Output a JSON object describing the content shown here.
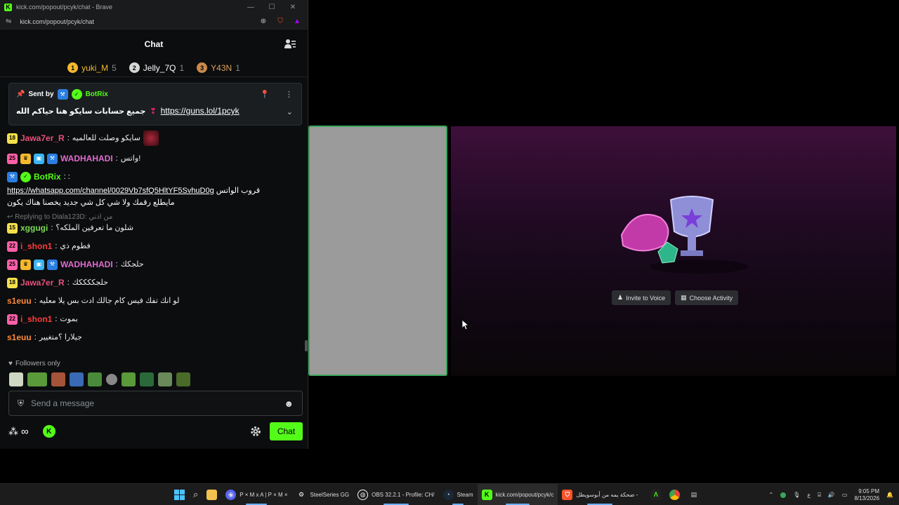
{
  "browser": {
    "window_title": "kick.com/popout/pcyk/chat - Brave",
    "url": "kick.com/popout/pcyk/chat"
  },
  "chat": {
    "header": "Chat",
    "leaderboard": [
      {
        "rank": "1",
        "name": "yuki_M",
        "count": "5",
        "color": "#f5b82e"
      },
      {
        "rank": "2",
        "name": "Jelly_7Q",
        "count": "1",
        "color": "#d8d8d8"
      },
      {
        "rank": "3",
        "name": "Y43N",
        "count": "1",
        "color": "#c98a4b"
      }
    ],
    "pinned": {
      "sent_by_label": "Sent by",
      "author": "BotRix",
      "text": "جميع حسابات سايكو هنا حياكم الله",
      "link": "https://guns.lol/1pcyk"
    },
    "messages": [
      {
        "badge": "18",
        "user": "Jawa7er_R",
        "text": "سايكو وصلت للعالميه"
      },
      {
        "badge": "25",
        "user": "WADHAHADI",
        "text": "واتس!"
      },
      {
        "user": "BotRix",
        "line1": "https://whatsapp.com/channel/0029Vb7sfQ5HltYF5SvhuD0g",
        "line1_suffix": "قروب الواتس",
        "line2": "مايطلع رقمك ولا شي كل شي جديد يخصنا هناك يكون"
      },
      {
        "reply": "Replying to Diala123D: من اذني",
        "badge": "15",
        "user": "xggugi",
        "text": "شلون ما تعرفين الملكه؟"
      },
      {
        "badge": "22",
        "user": "i_shon1",
        "text": "فطوم ذي"
      },
      {
        "badge": "25",
        "user": "WADHAHADI",
        "text": "حلجكك"
      },
      {
        "badge": "18",
        "user": "Jawa7er_R",
        "text": "حلجككككك"
      },
      {
        "user": "s1euu",
        "text": "لو انك تفك فيس كام جالك ادت بس يلا معليه"
      },
      {
        "badge": "22",
        "user": "i_shon1",
        "text": "بموت"
      },
      {
        "user": "s1euu",
        "text": "جيلارا ؟متغيير"
      }
    ],
    "followers_only": "Followers only",
    "composer_placeholder": "Send a message",
    "send_label": "Chat"
  },
  "activity": {
    "invite_label": "Invite to Voice",
    "choose_label": "Choose Activity"
  },
  "taskbar": {
    "items": [
      {
        "label": "P × M x A | P × M ×",
        "color": "#5865f2"
      },
      {
        "label": "SteelSeries GG",
        "color": "#ff6b00"
      },
      {
        "label": "OBS 32.2.1 - Profile: CH/",
        "color": "#302e31"
      },
      {
        "label": "Steam",
        "color": "#1b2838"
      },
      {
        "label": "kick.com/popout/pcyk/c",
        "color": "#53fc18"
      },
      {
        "label": "ضحكة يمه من أبوسويطل -",
        "color": "#fb542b"
      }
    ],
    "time": "9:05 PM",
    "date": "8/13/2026"
  }
}
